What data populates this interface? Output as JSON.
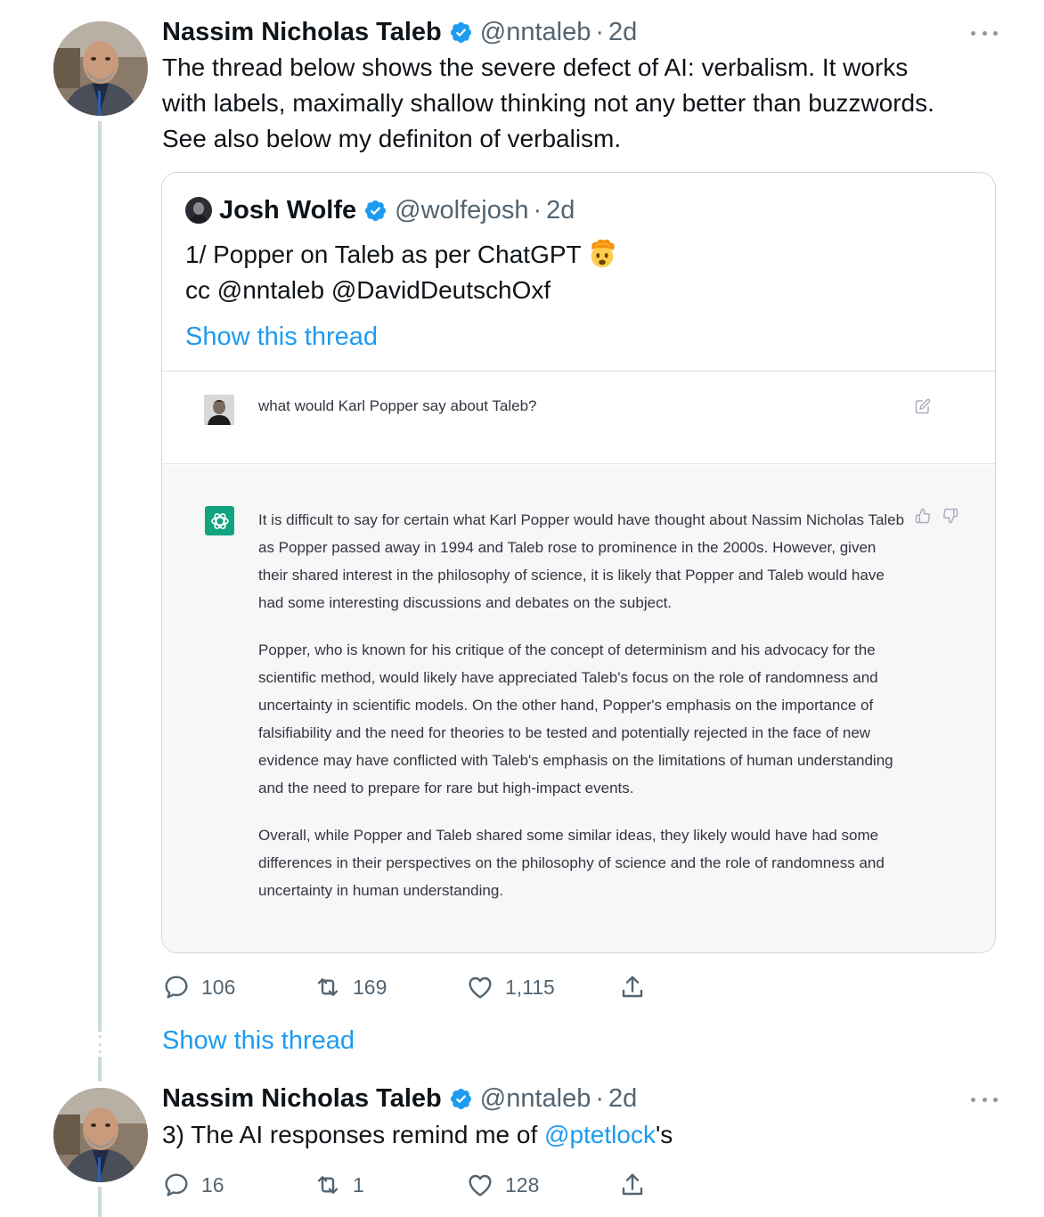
{
  "tweet1": {
    "name": "Nassim Nicholas Taleb",
    "handle": "@nntaleb",
    "separator": "·",
    "time": "2d",
    "lines": [
      "The thread below shows the severe defect of AI: verbalism. It works",
      "with labels, maximally shallow thinking not any better than buzzwords.",
      "See also below my definiton of verbalism."
    ],
    "quote": {
      "name": "Josh Wolfe",
      "handle": "@wolfejosh",
      "separator": "·",
      "time": "2d",
      "line1": "1/ Popper on Taleb as per ChatGPT",
      "emoji": "exploding-head-emoji",
      "line2": "cc @nntaleb @DavidDeutschOxf",
      "show_thread": "Show this thread",
      "chat": {
        "user_question": "what would Karl Popper say about Taleb?",
        "ai_paragraphs": [
          "It is difficult to say for certain what Karl Popper would have thought about Nassim Nicholas Taleb as Popper passed away in 1994 and Taleb rose to prominence in the 2000s. However, given their shared interest in the philosophy of science, it is likely that Popper and Taleb would have had some interesting discussions and debates on the subject.",
          "Popper, who is known for his critique of the concept of determinism and his advocacy for the scientific method, would likely have appreciated Taleb's focus on the role of randomness and uncertainty in scientific models. On the other hand, Popper's emphasis on the importance of falsifiability and the need for theories to be tested and potentially rejected in the face of new evidence may have conflicted with Taleb's emphasis on the limitations of human understanding and the need to prepare for rare but high-impact events.",
          "Overall, while Popper and Taleb shared some similar ideas, they likely would have had some differences in their perspectives on the philosophy of science and the role of randomness and uncertainty in human understanding."
        ]
      }
    },
    "stats": {
      "replies": "106",
      "retweets": "169",
      "likes": "1,115"
    }
  },
  "show_thread": "Show this thread",
  "tweet2": {
    "name": "Nassim Nicholas Taleb",
    "handle": "@nntaleb",
    "separator": "·",
    "time": "2d",
    "text_prefix": "3) The AI responses remind me of ",
    "mention": "@ptetlock",
    "text_suffix": "'s",
    "stats": {
      "replies": "16",
      "retweets": "1",
      "likes": "128"
    }
  },
  "icons": {
    "verified": "verified-badge-icon",
    "reply": "reply-icon",
    "retweet": "retweet-icon",
    "like": "like-icon",
    "share": "share-icon",
    "more": "more-icon",
    "edit": "edit-icon",
    "thumbs_up": "thumbs-up-icon",
    "thumbs_down": "thumbs-down-icon",
    "openai": "openai-logo-icon"
  },
  "colors": {
    "link": "#1d9bf0",
    "verified": "#1d9bf0",
    "secondary": "#536471",
    "openai": "#10a37f"
  }
}
